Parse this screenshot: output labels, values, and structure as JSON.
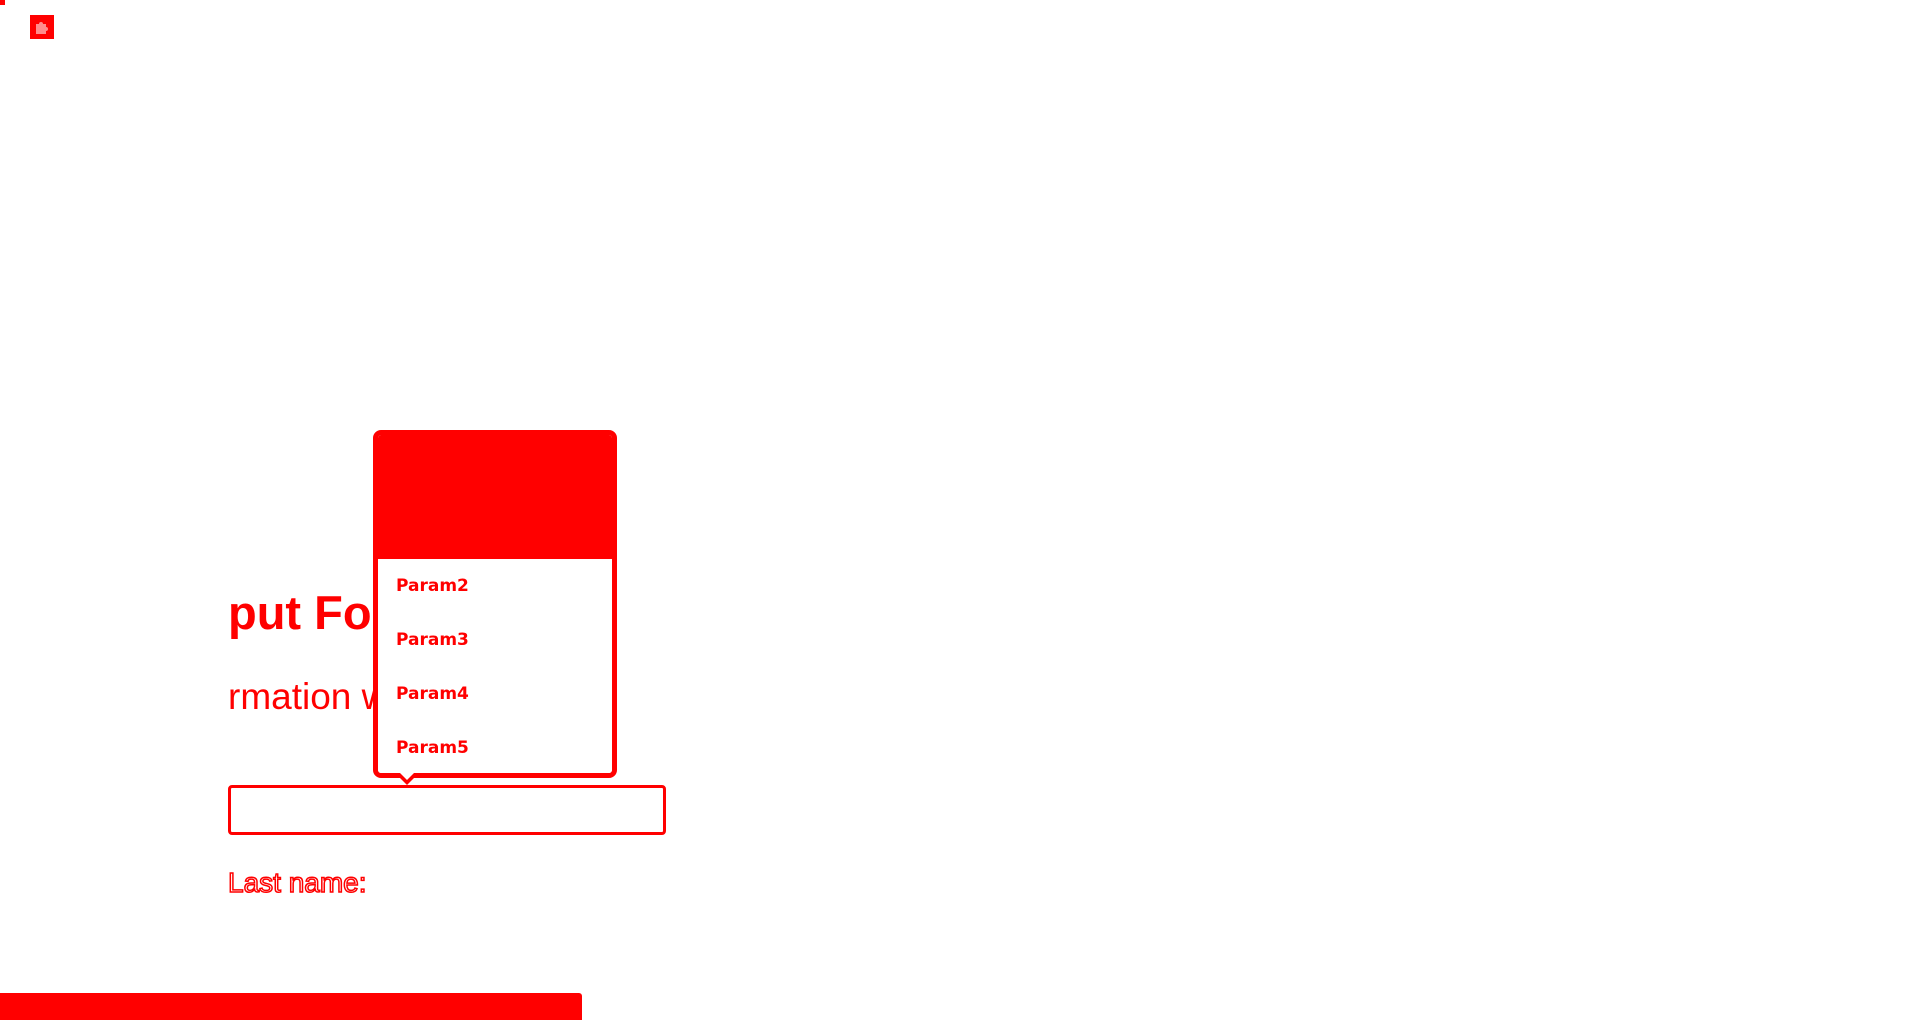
{
  "app": {
    "icon": "puzzle-icon"
  },
  "form": {
    "title_visible": "put Form",
    "description_visible": "rmation will be su",
    "first_name_value": "",
    "last_name_label": "Last name:"
  },
  "suggestions": {
    "items": [
      {
        "label": ""
      },
      {
        "label": "Param2"
      },
      {
        "label": "Param3"
      },
      {
        "label": "Param4"
      },
      {
        "label": "Param5"
      }
    ]
  },
  "colors": {
    "accent": "#ff0000",
    "background": "#ffffff"
  }
}
